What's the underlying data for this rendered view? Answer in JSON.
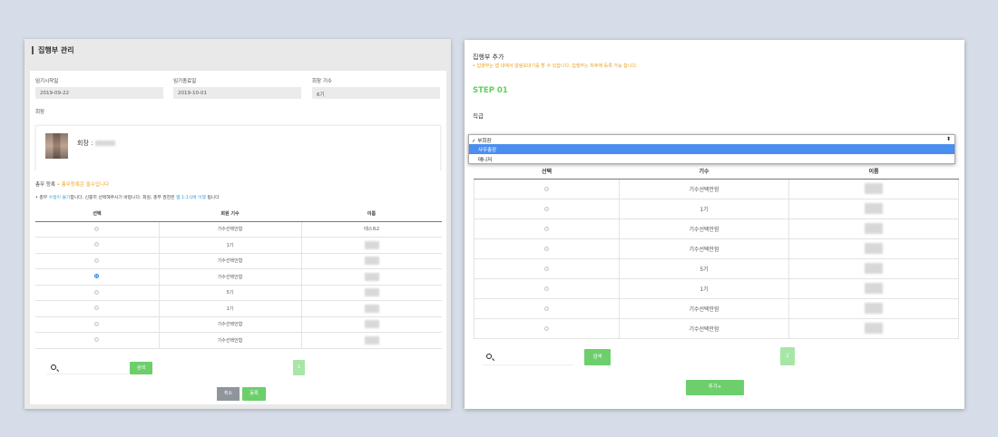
{
  "left": {
    "title": "집행부 관리",
    "fields": [
      {
        "label": "임기시작일",
        "value": "2019-09-22"
      },
      {
        "label": "임기종료일",
        "value": "2019-10-01"
      },
      {
        "label": "회장 기수",
        "value": "6기"
      }
    ],
    "president_label": "회장",
    "president_name_prefix": "회장 :",
    "treasurer": {
      "title": "총무 등록",
      "warning": "• 총무등록은 필수입니다",
      "note_prefix": "• 총무 ",
      "note_link1": "수정이 불가",
      "note_mid": "합니다. 신중히 선택해주시기 바랍니다. 회원, 총무 권한은 ",
      "note_link2": "앱 1:1식에 이행",
      "note_suffix": " 됩니다"
    },
    "table": {
      "headers": [
        "선택",
        "회원 기수",
        "이름"
      ],
      "rows": [
        {
          "gen": "기수선택안함",
          "name": "테스트2",
          "checked": false
        },
        {
          "gen": "1기",
          "name": "",
          "checked": false
        },
        {
          "gen": "기수선택안함",
          "name": "",
          "checked": false
        },
        {
          "gen": "기수선택안함",
          "name": "",
          "checked": true
        },
        {
          "gen": "5기",
          "name": "",
          "checked": false
        },
        {
          "gen": "1기",
          "name": "",
          "checked": false
        },
        {
          "gen": "기수선택안함",
          "name": "",
          "checked": false
        },
        {
          "gen": "기수선택안함",
          "name": "",
          "checked": false
        }
      ]
    },
    "search_button": "검색",
    "page": "1",
    "cancel_button": "취소",
    "register_button": "등록"
  },
  "right": {
    "title": "집행부 추가",
    "subtitle": "• 집행부는 앱 내에서 알림보내기를 할 수 있습니다. 집행부는 최후에 등록 가능 합니다.",
    "step": "STEP 01",
    "rank_label": "직급",
    "dropdown": {
      "selected": "✓ 부회장",
      "options": [
        "사무총장",
        "매니저"
      ],
      "highlighted": 0
    },
    "table": {
      "headers": [
        "선택",
        "기수",
        "이름"
      ],
      "rows": [
        {
          "gen": "기수선택안함"
        },
        {
          "gen": "1기"
        },
        {
          "gen": "기수선택안함"
        },
        {
          "gen": "기수선택안함"
        },
        {
          "gen": "5기"
        },
        {
          "gen": "1기"
        },
        {
          "gen": "기수선택안함"
        },
        {
          "gen": "기수선택안함"
        }
      ]
    },
    "search_button": "검색",
    "page": "1",
    "add_button": "추가+"
  },
  "colors": {
    "accent_green": "#6ccf6c",
    "warning_orange": "#f0a21c",
    "link_blue": "#2f9fe0",
    "highlight_blue": "#4a8ef0"
  }
}
